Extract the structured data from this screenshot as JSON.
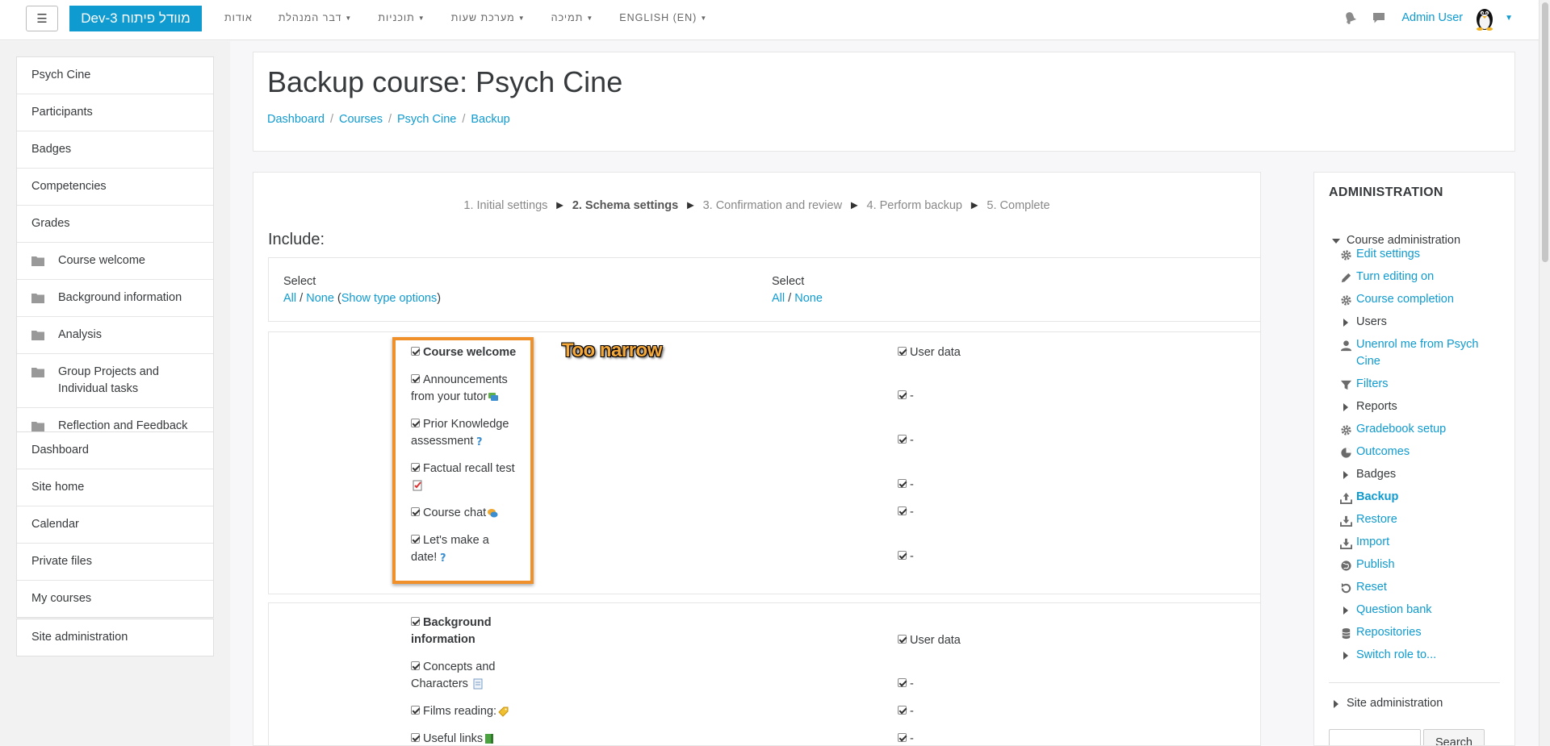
{
  "navbar": {
    "brand": "Dev-מוודל פיתוח 3",
    "menu": [
      {
        "label": "אודות",
        "has_caret": false
      },
      {
        "label": "דבר המנהלת",
        "has_caret": true
      },
      {
        "label": "תוכניות",
        "has_caret": true
      },
      {
        "label": "מערכת שעות",
        "has_caret": true
      },
      {
        "label": "תמיכה",
        "has_caret": true
      },
      {
        "label": "ENGLISH (EN)",
        "has_caret": true
      }
    ],
    "user_name": "Admin User"
  },
  "drawer": {
    "course_items": [
      {
        "label": "Psych Cine"
      },
      {
        "label": "Participants"
      },
      {
        "label": "Badges"
      },
      {
        "label": "Competencies"
      },
      {
        "label": "Grades"
      },
      {
        "label": "Course welcome"
      },
      {
        "label": "Background information"
      },
      {
        "label": "Analysis"
      },
      {
        "label": "Group Projects and Individual tasks"
      },
      {
        "label": "Reflection and Feedback"
      }
    ],
    "site_items": [
      {
        "label": "Dashboard"
      },
      {
        "label": "Site home"
      },
      {
        "label": "Calendar"
      },
      {
        "label": "Private files"
      },
      {
        "label": "My courses"
      }
    ],
    "admin_item": "Site administration"
  },
  "header": {
    "title": "Backup course: Psych Cine",
    "breadcrumb": [
      "Dashboard",
      "Courses",
      "Psych Cine",
      "Backup"
    ]
  },
  "backup": {
    "steps": [
      "1. Initial settings",
      "2. Schema settings",
      "3. Confirmation and review",
      "4. Perform backup",
      "5. Complete"
    ],
    "arrow": "►",
    "include_heading": "Include:",
    "select_left": {
      "label": "Select",
      "all": "All",
      "none": "None",
      "show_type": "Show type options"
    },
    "select_right": {
      "label": "Select",
      "all": "All",
      "none": "None"
    },
    "annotation": "Too narrow",
    "section1": {
      "title": "Course welcome",
      "user_data": "User data",
      "activities": [
        {
          "name_l1": "Announcements",
          "name_l2": "from your tutor",
          "icon": "forum-icon",
          "user_data": "-"
        },
        {
          "name_l1": "Prior Knowledge",
          "name_l2": "assessment",
          "icon": "question-icon",
          "user_data": "-"
        },
        {
          "name_l1": "Factual recall test",
          "name_l2": "",
          "icon": "quiz-icon",
          "user_data": "-"
        },
        {
          "name_l1": "Course chat",
          "name_l2": "",
          "icon": "chat-icon",
          "user_data": "-"
        },
        {
          "name_l1": "Let's make a",
          "name_l2": "date!",
          "icon": "question-icon",
          "user_data": "-"
        }
      ]
    },
    "section2": {
      "title_l1": "Background",
      "title_l2": "information",
      "user_data": "User data",
      "activities": [
        {
          "name_l1": "Concepts and",
          "name_l2": "Characters",
          "icon": "page-icon",
          "user_data": "-"
        },
        {
          "name_l1": "Films reading:",
          "name_l2": "",
          "icon": "tag-icon",
          "user_data": "-"
        },
        {
          "name_l1": "Useful links",
          "name_l2": "",
          "icon": "book-icon",
          "user_data": "-"
        }
      ]
    }
  },
  "admin": {
    "title": "ADMINISTRATION",
    "course_admin": "Course administration",
    "items": [
      {
        "label": "Edit settings",
        "icon": "gear-icon",
        "type": "link"
      },
      {
        "label": "Turn editing on",
        "icon": "pencil-icon",
        "type": "link"
      },
      {
        "label": "Course completion",
        "icon": "gear-icon",
        "type": "link"
      },
      {
        "label": "Users",
        "icon": "expand-icon",
        "type": "branch"
      },
      {
        "label": "Unenrol me from Psych Cine",
        "icon": "user-icon",
        "type": "link"
      },
      {
        "label": "Filters",
        "icon": "filter-icon",
        "type": "link"
      },
      {
        "label": "Reports",
        "icon": "expand-icon",
        "type": "branch"
      },
      {
        "label": "Gradebook setup",
        "icon": "gear-icon",
        "type": "link"
      },
      {
        "label": "Outcomes",
        "icon": "outcomes-icon",
        "type": "link"
      },
      {
        "label": "Badges",
        "icon": "expand-icon",
        "type": "branch"
      },
      {
        "label": "Backup",
        "icon": "upload-icon",
        "type": "active"
      },
      {
        "label": "Restore",
        "icon": "download-icon",
        "type": "link"
      },
      {
        "label": "Import",
        "icon": "download-icon",
        "type": "link"
      },
      {
        "label": "Publish",
        "icon": "globe-icon",
        "type": "link"
      },
      {
        "label": "Reset",
        "icon": "reset-icon",
        "type": "link"
      },
      {
        "label": "Question bank",
        "icon": "expand-icon",
        "type": "branch-link"
      },
      {
        "label": "Repositories",
        "icon": "database-icon",
        "type": "link"
      },
      {
        "label": "Switch role to...",
        "icon": "expand-icon",
        "type": "branch-link"
      }
    ],
    "site_admin": "Site administration",
    "search_button": "Search"
  }
}
